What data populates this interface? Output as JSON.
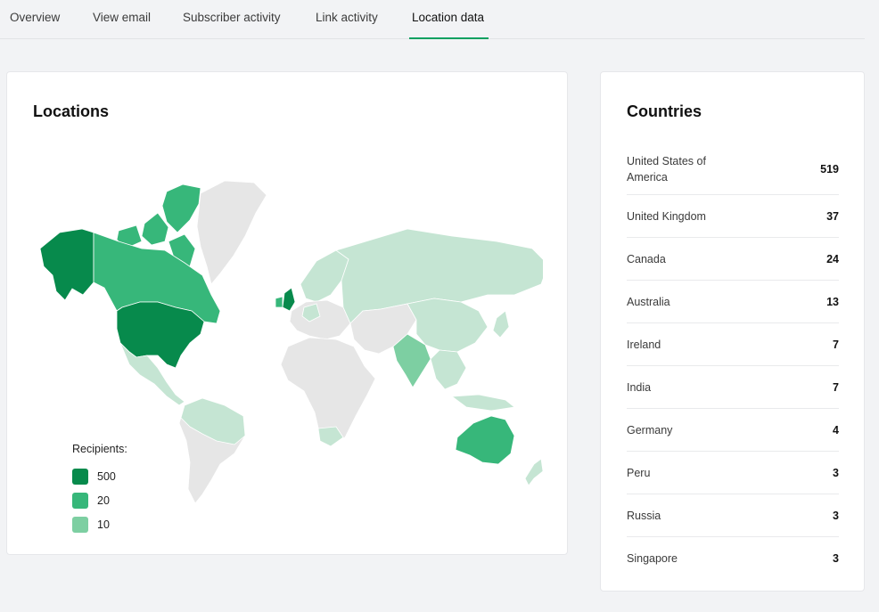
{
  "tabs": [
    {
      "label": "Overview"
    },
    {
      "label": "View email"
    },
    {
      "label": "Subscriber activity"
    },
    {
      "label": "Link activity"
    },
    {
      "label": "Location data",
      "active": true
    }
  ],
  "map_card": {
    "title": "Locations",
    "legend": {
      "title": "Recipients:",
      "items": [
        {
          "label": "500",
          "color": "#078a4c"
        },
        {
          "label": "20",
          "color": "#37b77a"
        },
        {
          "label": "10",
          "color": "#7dcfa2"
        }
      ]
    }
  },
  "countries_card": {
    "title": "Countries",
    "rows": [
      {
        "name": "United States of America",
        "count": "519"
      },
      {
        "name": "United Kingdom",
        "count": "37"
      },
      {
        "name": "Canada",
        "count": "24"
      },
      {
        "name": "Australia",
        "count": "13"
      },
      {
        "name": "Ireland",
        "count": "7"
      },
      {
        "name": "India",
        "count": "7"
      },
      {
        "name": "Germany",
        "count": "4"
      },
      {
        "name": "Peru",
        "count": "3"
      },
      {
        "name": "Russia",
        "count": "3"
      },
      {
        "name": "Singapore",
        "count": "3"
      }
    ]
  },
  "colors": {
    "accent": "#09a060",
    "map_dark": "#078a4c",
    "map_mid": "#37b77a",
    "map_light": "#7dcfa2",
    "map_pale": "#c5e5d3",
    "map_none": "#e6e6e6"
  }
}
